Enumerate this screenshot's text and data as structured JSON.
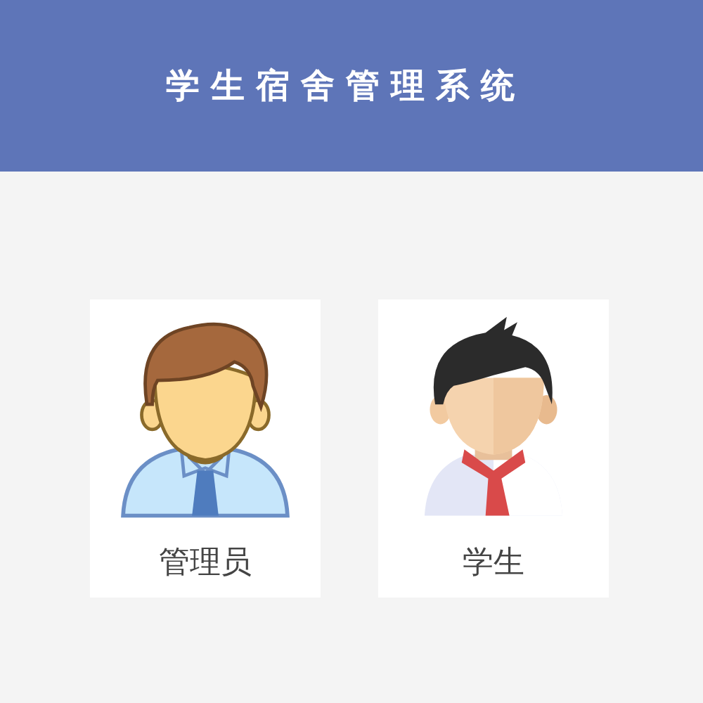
{
  "header": {
    "title": "学生宿舍管理系统"
  },
  "roles": [
    {
      "label": "管理员",
      "kind": "admin"
    },
    {
      "label": "学生",
      "kind": "student"
    }
  ]
}
